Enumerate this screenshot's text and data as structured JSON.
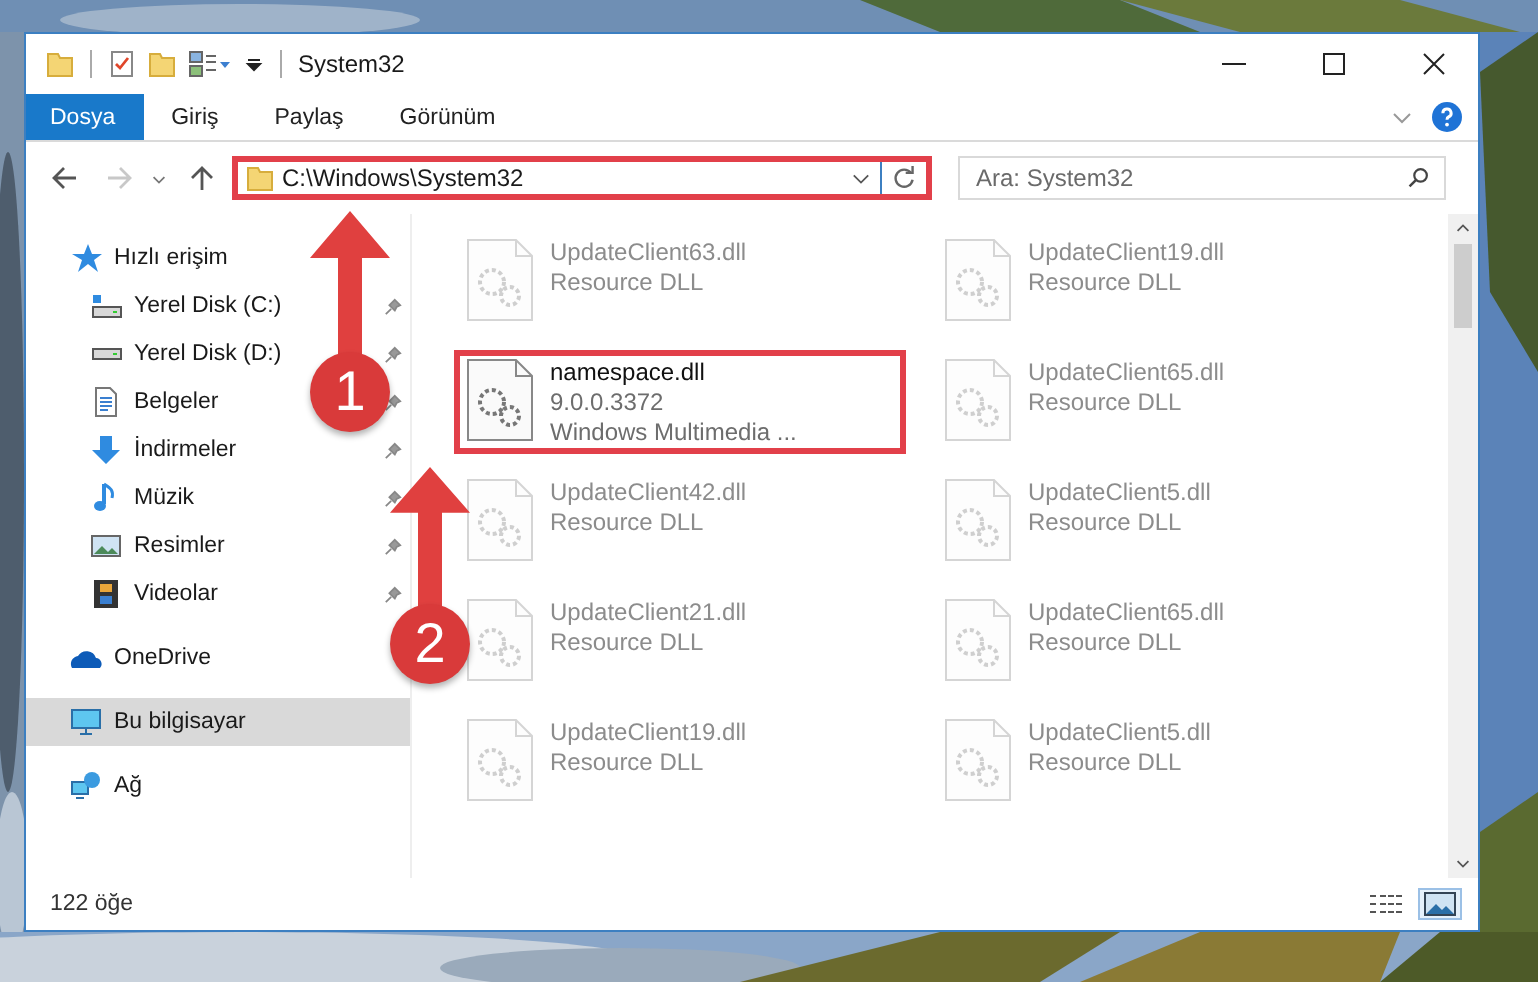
{
  "window": {
    "title": "System32"
  },
  "ribbon": {
    "tabs": [
      {
        "label": "Dosya",
        "selected": true
      },
      {
        "label": "Giriş",
        "selected": false
      },
      {
        "label": "Paylaş",
        "selected": false
      },
      {
        "label": "Görünüm",
        "selected": false
      }
    ]
  },
  "address_bar": {
    "path": "C:\\Windows\\System32",
    "highlighted": true
  },
  "search": {
    "placeholder": "Ara: System32"
  },
  "navigation": [
    {
      "label": "Hızlı erişim",
      "selected": false,
      "children": [
        {
          "label": "Yerel Disk (C:)",
          "pinned": true,
          "selected": false
        },
        {
          "label": "Yerel Disk (D:)",
          "pinned": true,
          "selected": false
        },
        {
          "label": "Belgeler",
          "pinned": true,
          "selected": false
        },
        {
          "label": "İndirmeler",
          "pinned": true,
          "selected": false
        },
        {
          "label": "Müzik",
          "pinned": true,
          "selected": false
        },
        {
          "label": "Resimler",
          "pinned": true,
          "selected": false
        },
        {
          "label": "Videolar",
          "pinned": true,
          "selected": false
        }
      ]
    },
    {
      "label": "OneDrive",
      "selected": false
    },
    {
      "label": "Bu bilgisayar",
      "selected": true
    },
    {
      "label": "Ağ",
      "selected": false
    }
  ],
  "files": [
    {
      "name": "UpdateClient63.dll",
      "details": [
        "Resource DLL"
      ],
      "blurred": true,
      "highlighted": false
    },
    {
      "name": "UpdateClient19.dll",
      "details": [
        "Resource DLL"
      ],
      "blurred": true,
      "highlighted": false
    },
    {
      "name": "namespace.dll",
      "details": [
        "9.0.0.3372",
        "Windows Multimedia ..."
      ],
      "blurred": false,
      "highlighted": true
    },
    {
      "name": "UpdateClient65.dll",
      "details": [
        "Resource DLL"
      ],
      "blurred": true,
      "highlighted": false
    },
    {
      "name": "UpdateClient42.dll",
      "details": [
        "Resource DLL"
      ],
      "blurred": true,
      "highlighted": false
    },
    {
      "name": "UpdateClient5.dll",
      "details": [
        "Resource DLL"
      ],
      "blurred": true,
      "highlighted": false
    },
    {
      "name": "UpdateClient21.dll",
      "details": [
        "Resource DLL"
      ],
      "blurred": true,
      "highlighted": false
    },
    {
      "name": "UpdateClient65.dll",
      "details": [
        "Resource DLL"
      ],
      "blurred": true,
      "highlighted": false
    },
    {
      "name": "UpdateClient19.dll",
      "details": [
        "Resource DLL"
      ],
      "blurred": true,
      "highlighted": false
    },
    {
      "name": "UpdateClient5.dll",
      "details": [
        "Resource DLL"
      ],
      "blurred": true,
      "highlighted": false
    }
  ],
  "status_bar": {
    "item_count": "122 öğe",
    "views": [
      {
        "selected": false
      },
      {
        "selected": true
      }
    ]
  },
  "annotations": [
    {
      "label": "1"
    },
    {
      "label": "2"
    }
  ]
}
